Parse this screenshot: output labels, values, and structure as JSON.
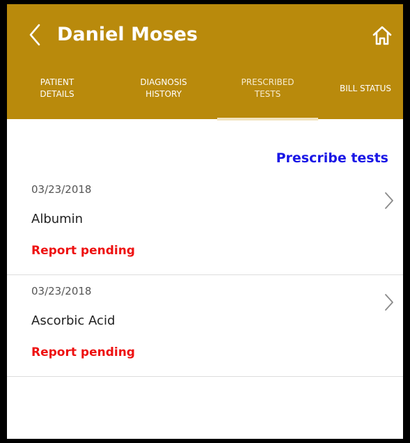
{
  "header": {
    "title": "Daniel Moses",
    "background_color": "#b98a0c",
    "back_icon": "chevron-left-icon",
    "home_icon": "home-icon"
  },
  "tabs": [
    {
      "label": "PATIENT\nDETAILS",
      "active": false
    },
    {
      "label": "DIAGNOSIS\nHISTORY",
      "active": false
    },
    {
      "label": "PRESCRIBED\nTESTS",
      "active": true
    },
    {
      "label": "BILL STATUS",
      "active": false
    }
  ],
  "actions": {
    "prescribe_label": "Prescribe tests",
    "link_color": "#1a17e6"
  },
  "tests": [
    {
      "date": "03/23/2018",
      "name": "Albumin",
      "status": "Report pending"
    },
    {
      "date": "03/23/2018",
      "name": "Ascorbic Acid",
      "status": "Report pending"
    }
  ],
  "colors": {
    "status_pending": "#ee1111"
  }
}
